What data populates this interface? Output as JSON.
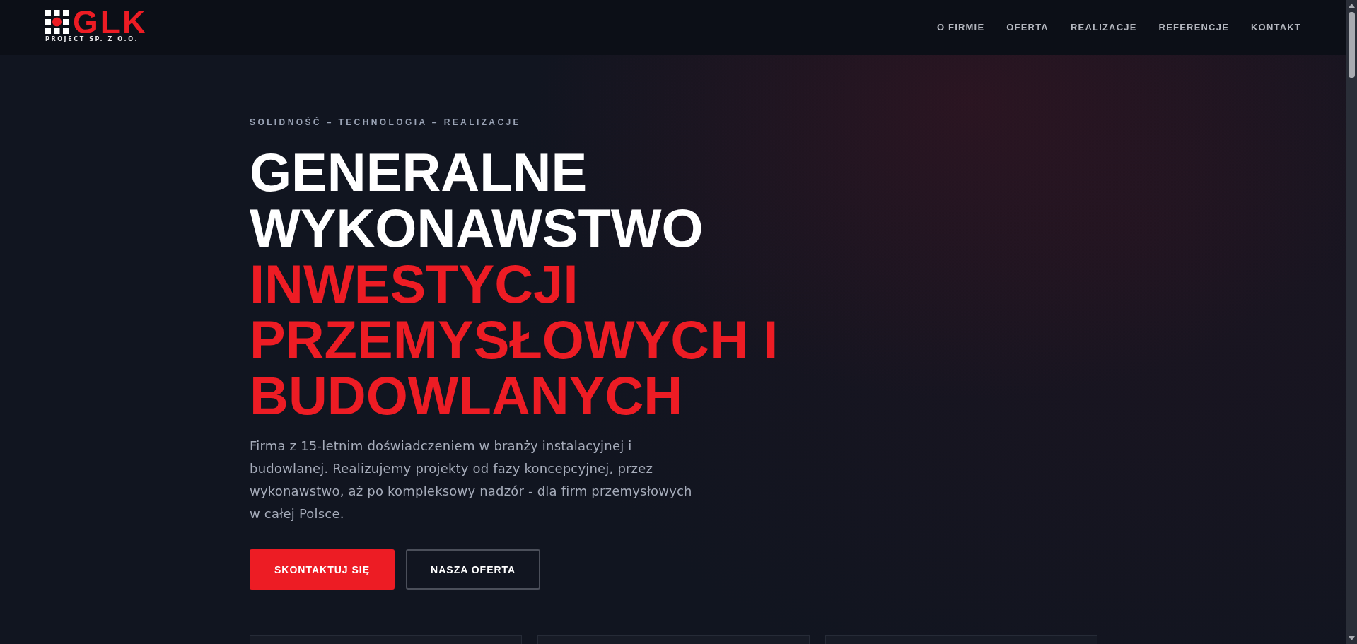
{
  "header": {
    "logo": {
      "mark": "GLK",
      "subtitle": "PROJECT SP. Z O.O."
    },
    "nav": [
      {
        "label": "O FIRMIE"
      },
      {
        "label": "OFERTA"
      },
      {
        "label": "REALIZACJE"
      },
      {
        "label": "REFERENCJE"
      },
      {
        "label": "KONTAKT"
      }
    ]
  },
  "hero": {
    "tagline": "SOLIDNOŚĆ – TECHNOLOGIA – REALIZACJE",
    "heading": "GENERALNE WYKONAWSTWO",
    "heading_accent": "INWESTYCJI PRZEMYSŁOWYCH I BUDOWLANYCH",
    "description": "Firma z 15-letnim doświadczeniem w branży instalacyjnej i budowlanej. Realizujemy projekty od fazy koncepcyjnej, przez wykonawstwo, aż po kompleksowy nadzór - dla firm przemysłowych w całej Polsce.",
    "buttons": [
      {
        "label": "SKONTAKTUJ SIĘ",
        "kind": "primary"
      },
      {
        "label": "NASZA OFERTA",
        "kind": "outline"
      }
    ]
  }
}
